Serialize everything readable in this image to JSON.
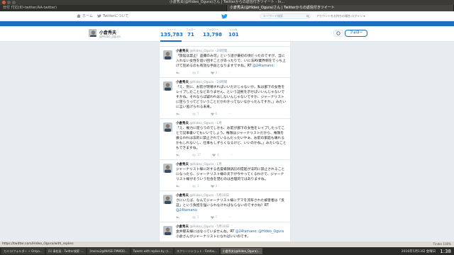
{
  "window": {
    "title": "小倉秀夫(@Hideo_Ogura)さん | Twitterからの返信付きツイート - In..."
  },
  "tabs": [
    {
      "label": "日付 付近(ID-twitter/AA-twitter)",
      "active": false
    },
    {
      "label": "小倉秀夫(@Hideo_Ogura)さん | Twitterからの返信付きツイート",
      "active": true
    }
  ],
  "nav": {
    "home_label": "ホーム",
    "about_label": "Twitterについて",
    "search_placeholder": "キーワード検索",
    "login_text": "アカウントをお持ちの場合 ログイン ▾"
  },
  "profile": {
    "name": "小倉秀夫",
    "handle": "@Hideo_Ogura",
    "follow_label": "フォロー",
    "stats": [
      {
        "label": "ツイート",
        "value": "135,783"
      },
      {
        "label": "フォロー",
        "value": "71"
      },
      {
        "label": "フォロワー",
        "value": "13,798"
      },
      {
        "label": "いいね",
        "value": "101"
      }
    ]
  },
  "tweets": {
    "partial_top": "",
    "items": [
      {
        "name": "小倉秀夫",
        "meta": "@Hideo_Ogura · 24時間",
        "text": "「旅館は禁止！盗撮のみ可」という話が最初の頃だったのですが、当に入れない女性を追い回すことがあったりで、いに法AV業界側をでっち上げて犯めるのも有効な手段となりますですね。RT",
        "mention": "@24tamano:",
        "reply": "",
        "retweet": "6",
        "like": "4"
      },
      {
        "name": "小倉秀夫",
        "meta": "@Hideo_Ogura · 24時間",
        "text": "「え、別に、お前が現場すればいいだけじゃないか。私は部下の女性をレイプしたことなどありません、という証拠を示せばいいんじゃないですかね。それならば疑われはしないんじゃないですか、ジャーナリストに逆らうってどういうことだかわかってないなかったんですか。」みたいに言い逃げられる未来。",
        "mention": "",
        "reply": "",
        "retweet": "7",
        "like": "6"
      },
      {
        "name": "小倉秀夫",
        "meta": "@Hideo_Ogura · 1月",
        "text": "「え、権力に逆らうのでしかも、お前が部下の女性をレイプしたってことで記事書いてもいいでしょう。権限はジャーナリストだから、権限を振るわれは法的に禁止されているんだったいやぁ、お前の家庭も壊れるかもしれないし、仕事もしずらくなるけど、いいのかね。」みたいなこともできますね。",
        "mention": "",
        "reply": "",
        "retweet": "17",
        "like": "6"
      },
      {
        "name": "小倉秀夫",
        "meta": "@Hideo_Ogura · 1月",
        "text": "ジャーナリスト様に対する名誉毀損訴訟の提起が法的に禁止されることになったら、ジャーナリスト様の天下が今やってくるわけで、ジャーナリスト様がそういう社会を望むのは合理的ではありますね。",
        "mention": "",
        "reply": "",
        "retweet": "3",
        "like": "4"
      },
      {
        "name": "小倉秀夫",
        "meta": "@Hideo_Ogura · 5月10日",
        "text": "さにいえば、なんでジャーナリスト様にデマを流布された被害者は「反証」という負担を強いられなければならないのですかね？RT",
        "mention": "@24tamano:",
        "reply": "",
        "retweet": "5",
        "like": "7"
      },
      {
        "name": "小倉秀夫",
        "meta": "@Hideo_Ogura · 5月10日",
        "text": "金井郁夫様にはなっていませんね。RT",
        "mention": "@24tamano: @Hideo_Ogura",
        "text2": "小倉さんがジャーナリストになればいいのです。",
        "reply": "",
        "retweet": "",
        "like": ""
      }
    ]
  },
  "status": {
    "url": "https://twitter.com/Hideo_Ogura/with_replies",
    "right": "Tinder 100%"
  },
  "taskbar": {
    "items": [
      {
        "label": "カメラ/フォルダー ~ Onlyo...",
        "active": false
      },
      {
        "label": "(1) 青松長 - Twitter検索 -...",
        "active": false
      },
      {
        "label": "[moinu2@INASE-FMWD0...",
        "active": false
      },
      {
        "label": "Tweets with replies by 小...",
        "active": false
      },
      {
        "label": "スクリーンショット - Firefox...",
        "active": false
      },
      {
        "label": "小倉秀夫(@Hideo_Ogura)...",
        "active": true
      }
    ],
    "date": "2016年5月13日 金曜日",
    "time": "1:38"
  }
}
